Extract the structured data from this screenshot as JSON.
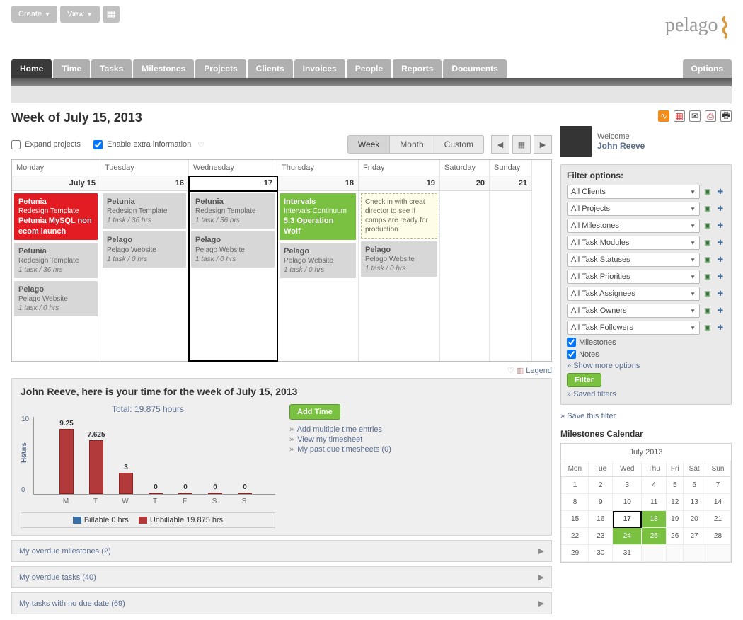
{
  "topButtons": {
    "create": "Create",
    "view": "View"
  },
  "logo": "pelago",
  "tabs": [
    "Home",
    "Time",
    "Tasks",
    "Milestones",
    "Projects",
    "Clients",
    "Invoices",
    "People",
    "Reports",
    "Documents"
  ],
  "optionsTab": "Options",
  "weekTitle": "Week of July 15, 2013",
  "controls": {
    "expand": "Expand projects",
    "extra": "Enable extra information",
    "views": [
      "Week",
      "Month",
      "Custom"
    ]
  },
  "days": [
    {
      "name": "Monday",
      "label": "July 15"
    },
    {
      "name": "Tuesday",
      "label": "16"
    },
    {
      "name": "Wednesday",
      "label": "17"
    },
    {
      "name": "Thursday",
      "label": "18"
    },
    {
      "name": "Friday",
      "label": "19"
    },
    {
      "name": "Saturday",
      "label": "20"
    },
    {
      "name": "Sunday",
      "label": "21"
    }
  ],
  "cards": {
    "mon": [
      {
        "t": "red",
        "title": "Petunia",
        "sub": "Redesign Template",
        "extra": "Petunia MySQL non ecom launch"
      },
      {
        "t": "grey",
        "title": "Petunia",
        "sub": "Redesign Template",
        "meta": "1 task / 36 hrs"
      },
      {
        "t": "grey",
        "title": "Pelago",
        "sub": "Pelago Website",
        "meta": "1 task / 0 hrs"
      }
    ],
    "tue": [
      {
        "t": "grey",
        "title": "Petunia",
        "sub": "Redesign Template",
        "meta": "1 task / 36 hrs"
      },
      {
        "t": "grey",
        "title": "Pelago",
        "sub": "Pelago Website",
        "meta": "1 task / 0 hrs"
      }
    ],
    "wed": [
      {
        "t": "grey",
        "title": "Petunia",
        "sub": "Redesign Template",
        "meta": "1 task / 36 hrs"
      },
      {
        "t": "grey",
        "title": "Pelago",
        "sub": "Pelago Website",
        "meta": "1 task / 0 hrs"
      }
    ],
    "thu": [
      {
        "t": "green",
        "title": "Intervals",
        "sub": "Intervals Continuum",
        "extra": "5.3 Operation Wolf"
      },
      {
        "t": "grey",
        "title": "Pelago",
        "sub": "Pelago Website",
        "meta": "1 task / 0 hrs"
      }
    ],
    "fri": [
      {
        "t": "note",
        "text": "Check in with creat director to see if comps are ready for production"
      },
      {
        "t": "grey",
        "title": "Pelago",
        "sub": "Pelago Website",
        "meta": "1 task / 0 hrs"
      }
    ]
  },
  "legendLabel": "Legend",
  "timePanel": {
    "title": "John Reeve, here is your time for the week of July 15, 2013",
    "total": "Total: 19.875 hours",
    "addTime": "Add Time",
    "links": [
      "Add multiple time entries",
      "View my timesheet",
      "My past due timesheets (0)"
    ],
    "legend": {
      "billable": "Billable 0 hrs",
      "unbillable": "Unbillable 19.875 hrs"
    }
  },
  "chart_data": {
    "type": "bar",
    "categories": [
      "M",
      "T",
      "W",
      "T",
      "F",
      "S",
      "S"
    ],
    "values": [
      9.25,
      7.625,
      3,
      0,
      0,
      0,
      0
    ],
    "ylabel": "Hours",
    "ylim": [
      0,
      10
    ],
    "series_legend": [
      {
        "name": "Billable",
        "value": "0 hrs",
        "color": "#3b6ea5"
      },
      {
        "name": "Unbillable",
        "value": "19.875 hrs",
        "color": "#b23a3a"
      }
    ]
  },
  "accordions": [
    "My overdue milestones (2)",
    "My overdue tasks (40)",
    "My tasks with no due date (69)"
  ],
  "welcome": {
    "label": "Welcome",
    "name": "John Reeve"
  },
  "filter": {
    "title": "Filter options:",
    "selects": [
      "All Clients",
      "All Projects",
      "All Milestones",
      "All Task Modules",
      "All Task Statuses",
      "All Task Priorities",
      "All Task Assignees",
      "All Task Owners",
      "All Task Followers"
    ],
    "milestones": "Milestones",
    "notes": "Notes",
    "showMore": "Show more options",
    "filterBtn": "Filter",
    "saved": "Saved filters",
    "saveThis": "Save this filter"
  },
  "miniCal": {
    "title": "Milestones Calendar",
    "month": "July 2013",
    "dow": [
      "Mon",
      "Tue",
      "Wed",
      "Thu",
      "Fri",
      "Sat",
      "Sun"
    ],
    "weeks": [
      [
        1,
        2,
        3,
        4,
        5,
        6,
        7
      ],
      [
        8,
        9,
        10,
        11,
        12,
        13,
        14
      ],
      [
        15,
        16,
        17,
        18,
        19,
        20,
        21
      ],
      [
        22,
        23,
        24,
        25,
        26,
        27,
        28
      ],
      [
        29,
        30,
        31,
        "",
        "",
        "",
        ""
      ]
    ],
    "today": 17,
    "green": [
      18,
      24,
      25
    ]
  }
}
